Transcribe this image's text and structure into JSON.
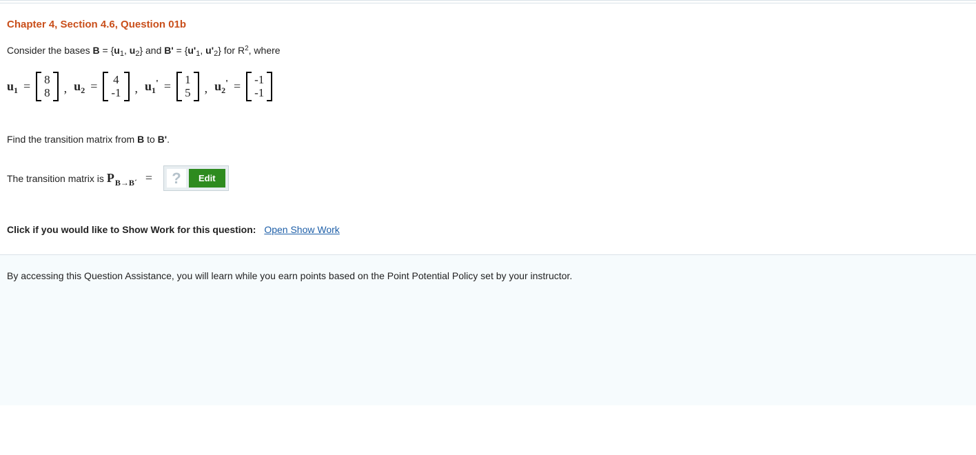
{
  "title": "Chapter 4, Section 4.6, Question 01b",
  "intro": {
    "pre": "Consider the bases ",
    "B": "B",
    "eq1": " = {",
    "u1": "u",
    "s1": "1",
    "c1": ", ",
    "u2": "u",
    "s2": "2",
    "close1": "} and ",
    "Bp": "B'",
    "eq2": " = {",
    "up1": "u'",
    "sp1": "1",
    "c2": ", ",
    "up2": "u'",
    "sp2": "2",
    "for": "} for R",
    "exp": "2",
    "where": ", where"
  },
  "vectors": {
    "u1": {
      "label": "u",
      "sub": "1",
      "top": "8",
      "bot": "8"
    },
    "u2": {
      "label": "u",
      "sub": "2",
      "top": "4",
      "bot": "-1"
    },
    "up1": {
      "label": "u",
      "sub": "1",
      "prime": "'",
      "top": "1",
      "bot": "5"
    },
    "up2": {
      "label": "u",
      "sub": "2",
      "prime": "'",
      "top": "-1",
      "bot": "-1"
    }
  },
  "instruction": {
    "pre": "Find the transition matrix from ",
    "B": "B",
    "mid": " to ",
    "Bp": "B'",
    "end": "."
  },
  "answer": {
    "pre": "The transition matrix is ",
    "P": "P",
    "Psub": "B→B´",
    "eq": "=",
    "placeholder": "?",
    "edit": "Edit"
  },
  "showwork": {
    "label": "Click if you would like to Show Work for this question:",
    "link": "Open Show Work"
  },
  "footer": "By accessing this Question Assistance, you will learn while you earn points based on the Point Potential Policy set by your instructor."
}
